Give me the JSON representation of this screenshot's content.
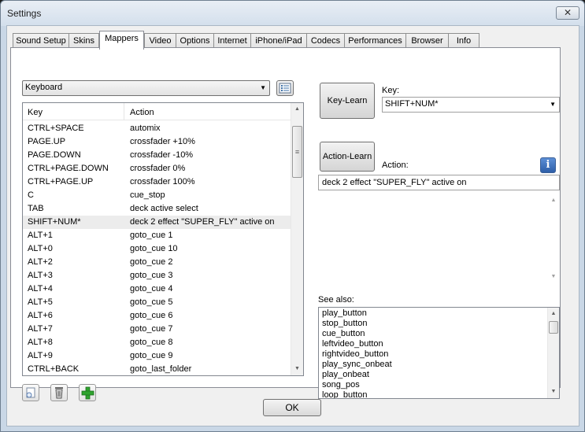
{
  "window": {
    "title": "Settings",
    "close_label": "✕"
  },
  "tabs": [
    {
      "label": "Sound Setup"
    },
    {
      "label": "Skins"
    },
    {
      "label": "Mappers",
      "active": true
    },
    {
      "label": "Video"
    },
    {
      "label": "Options"
    },
    {
      "label": "Internet"
    },
    {
      "label": "iPhone/iPad"
    },
    {
      "label": "Codecs"
    },
    {
      "label": "Performances"
    },
    {
      "label": "Browser"
    },
    {
      "label": "Info"
    }
  ],
  "mapper": {
    "device_selected": "Keyboard",
    "columns": {
      "key": "Key",
      "action": "Action"
    },
    "rows": [
      {
        "key": "CTRL+SPACE",
        "action": "automix"
      },
      {
        "key": "PAGE.UP",
        "action": "crossfader +10%"
      },
      {
        "key": "PAGE.DOWN",
        "action": "crossfader -10%"
      },
      {
        "key": "CTRL+PAGE.DOWN",
        "action": "crossfader 0%"
      },
      {
        "key": "CTRL+PAGE.UP",
        "action": "crossfader 100%"
      },
      {
        "key": "C",
        "action": "cue_stop"
      },
      {
        "key": "TAB",
        "action": "deck active select"
      },
      {
        "key": "SHIFT+NUM*",
        "action": "deck 2 effect \"SUPER_FLY\" active on",
        "selected": true
      },
      {
        "key": "ALT+1",
        "action": "goto_cue 1"
      },
      {
        "key": "ALT+0",
        "action": "goto_cue 10"
      },
      {
        "key": "ALT+2",
        "action": "goto_cue 2"
      },
      {
        "key": "ALT+3",
        "action": "goto_cue 3"
      },
      {
        "key": "ALT+4",
        "action": "goto_cue 4"
      },
      {
        "key": "ALT+5",
        "action": "goto_cue 5"
      },
      {
        "key": "ALT+6",
        "action": "goto_cue 6"
      },
      {
        "key": "ALT+7",
        "action": "goto_cue 7"
      },
      {
        "key": "ALT+8",
        "action": "goto_cue 8"
      },
      {
        "key": "ALT+9",
        "action": "goto_cue 9"
      },
      {
        "key": "CTRL+BACK",
        "action": "goto_last_folder"
      }
    ]
  },
  "editor": {
    "key_learn_label": "Key-Learn",
    "key_label": "Key:",
    "key_value": "SHIFT+NUM*",
    "action_learn_label": "Action-Learn",
    "action_label": "Action:",
    "action_value": "deck 2 effect \"SUPER_FLY\" active on",
    "see_also_label": "See also:",
    "see_also": [
      "play_button",
      "stop_button",
      "cue_button",
      "leftvideo_button",
      "rightvideo_button",
      "play_sync_onbeat",
      "play_onbeat",
      "song_pos",
      "loop_button"
    ]
  },
  "footer": {
    "ok_label": "OK"
  },
  "icons": {
    "list_view": "list-view-icon",
    "new_mapping": "new-mapping-icon",
    "delete": "trash-icon",
    "add": "plus-icon",
    "info": "info-icon"
  },
  "colors": {
    "add_icon": "#2ea32e",
    "info_icon": "#2d5ea8",
    "selected_row": "#ececec"
  }
}
